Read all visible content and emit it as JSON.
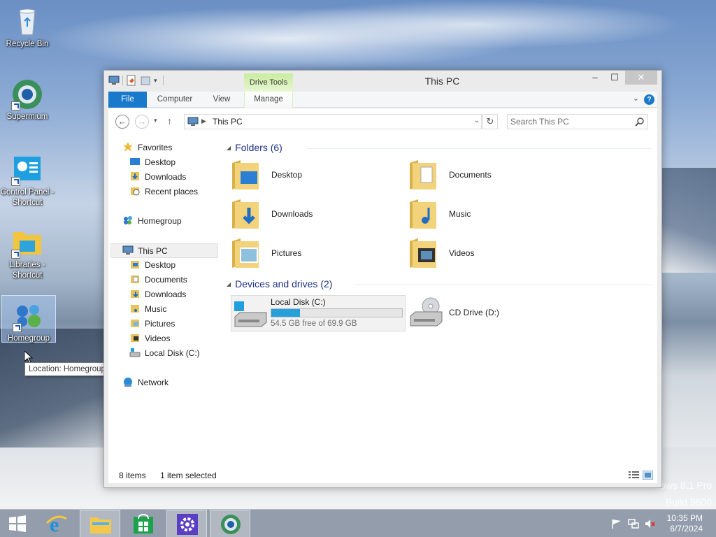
{
  "desktop": {
    "icons": [
      {
        "label": "Recycle Bin",
        "icon": "recycle-bin-icon"
      },
      {
        "label": "Supermium",
        "icon": "supermium-icon"
      },
      {
        "label": "Control Panel - Shortcut",
        "icon": "control-panel-icon"
      },
      {
        "label": "Libraries - Shortcut",
        "icon": "libraries-icon"
      },
      {
        "label": "Homegroup",
        "icon": "homegroup-icon"
      }
    ],
    "tooltip": "Location: Homegroup",
    "watermark": {
      "line1": "ows 8.1 Pro",
      "line2": "Build 9600"
    }
  },
  "window": {
    "title": "This PC",
    "contextual_tab": "Drive Tools",
    "ribbon_tabs": [
      "File",
      "Computer",
      "View",
      "Manage"
    ],
    "controls": {
      "minimize": "–",
      "maximize": "☐",
      "close": "✕"
    },
    "address": {
      "crumb": "This PC"
    },
    "search": {
      "placeholder": "Search This PC"
    }
  },
  "navpane": {
    "favorites": {
      "label": "Favorites",
      "items": [
        "Desktop",
        "Downloads",
        "Recent places"
      ]
    },
    "homegroup": "Homegroup",
    "thispc": {
      "label": "This PC",
      "items": [
        "Desktop",
        "Documents",
        "Downloads",
        "Music",
        "Pictures",
        "Videos",
        "Local Disk (C:)"
      ]
    },
    "network": "Network"
  },
  "main": {
    "folders_header": "Folders (6)",
    "folders": [
      "Desktop",
      "Documents",
      "Downloads",
      "Music",
      "Pictures",
      "Videos"
    ],
    "devices_header": "Devices and drives (2)",
    "drives": [
      {
        "name": "Local Disk (C:)",
        "free_text": "54.5 GB free of 69.9 GB",
        "used_fraction": 0.22
      },
      {
        "name": "CD Drive (D:)"
      }
    ]
  },
  "statusbar": {
    "items": "8 items",
    "selected": "1 item selected"
  },
  "taskbar": {
    "pinned": [
      "start-button",
      "internet-explorer-icon",
      "file-explorer-icon",
      "store-icon",
      "settings-icon",
      "supermium-icon"
    ],
    "time": "10:35 PM",
    "date": "6/7/2024"
  },
  "colors": {
    "accent": "#1979ca",
    "drive_bar": "#26a0da",
    "group_header": "#1e3287"
  }
}
